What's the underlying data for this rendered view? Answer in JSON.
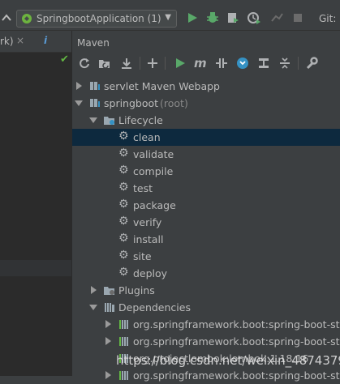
{
  "topbar": {
    "run_config": "SpringbootApplication (1)",
    "git_label": "Git:"
  },
  "editor_tab": {
    "label": "rk)",
    "close": "×",
    "info": "i"
  },
  "maven": {
    "title": "Maven",
    "tree": [
      {
        "label": "servlet Maven Webapp"
      },
      {
        "label": "springboot",
        "suffix": "(root)"
      },
      {
        "label": "Lifecycle"
      },
      {
        "label": "clean"
      },
      {
        "label": "validate"
      },
      {
        "label": "compile"
      },
      {
        "label": "test"
      },
      {
        "label": "package"
      },
      {
        "label": "verify"
      },
      {
        "label": "install"
      },
      {
        "label": "site"
      },
      {
        "label": "deploy"
      },
      {
        "label": "Plugins"
      },
      {
        "label": "Dependencies"
      },
      {
        "label": "org.springframework.boot:spring-boot-star"
      },
      {
        "label": "org.springframework.boot:spring-boot-star"
      },
      {
        "label": "org.projectlombok:lombok:1.18.16"
      },
      {
        "label": "org.springframework.boot:spring-boot-star"
      }
    ]
  },
  "watermark": "https://blog.csdn.net/weixin_48743799",
  "colors": {
    "panel_bg": "#3c3f41",
    "editor_bg": "#2b2b2b",
    "selection": "#0d293e",
    "run_green": "#59a869",
    "accent_blue": "#3592c4"
  }
}
